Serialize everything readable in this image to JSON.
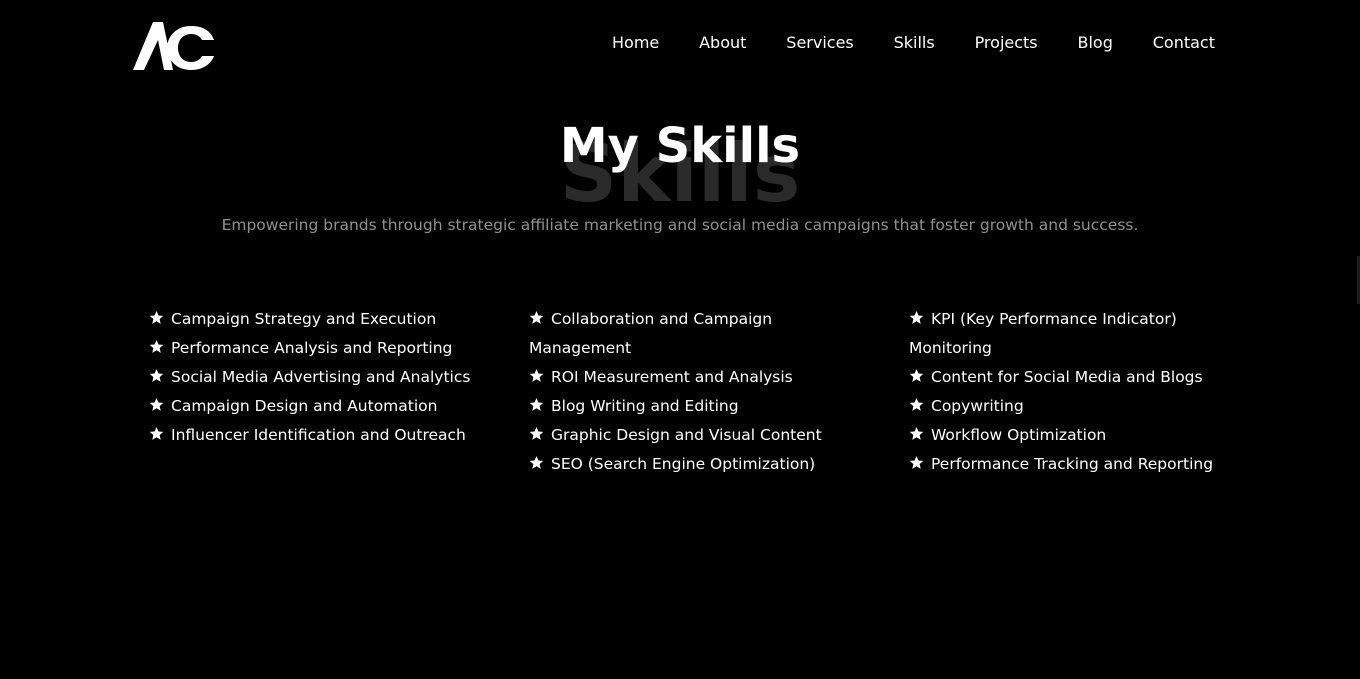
{
  "header": {
    "logo_text": "AC",
    "nav": [
      "Home",
      "About",
      "Services",
      "Skills",
      "Projects",
      "Blog",
      "Contact"
    ]
  },
  "section": {
    "title": "My Skills",
    "ghost_text": "Skills",
    "subtitle": "Empowering brands through strategic affiliate marketing and social media campaigns that foster growth and success."
  },
  "skills": {
    "column1": [
      "Campaign Strategy and Execution",
      "Performance Analysis and Reporting",
      "Social Media Advertising and Analytics",
      "Campaign Design and Automation",
      "Influencer Identification and Outreach"
    ],
    "column2": [
      "Collaboration and Campaign Management",
      "ROI Measurement and Analysis",
      "Blog Writing and Editing",
      "Graphic Design and Visual Content",
      "SEO (Search Engine Optimization)"
    ],
    "column3": [
      "KPI (Key Performance Indicator) Monitoring",
      "Content for Social Media and Blogs",
      "Copywriting",
      "Workflow Optimization",
      "Performance Tracking and Reporting"
    ]
  },
  "icons": {
    "bullet": "star-icon"
  },
  "colors": {
    "background": "#000000",
    "text": "#ffffff",
    "muted": "#8f8f8f",
    "ghost": "#2a2a2a"
  }
}
